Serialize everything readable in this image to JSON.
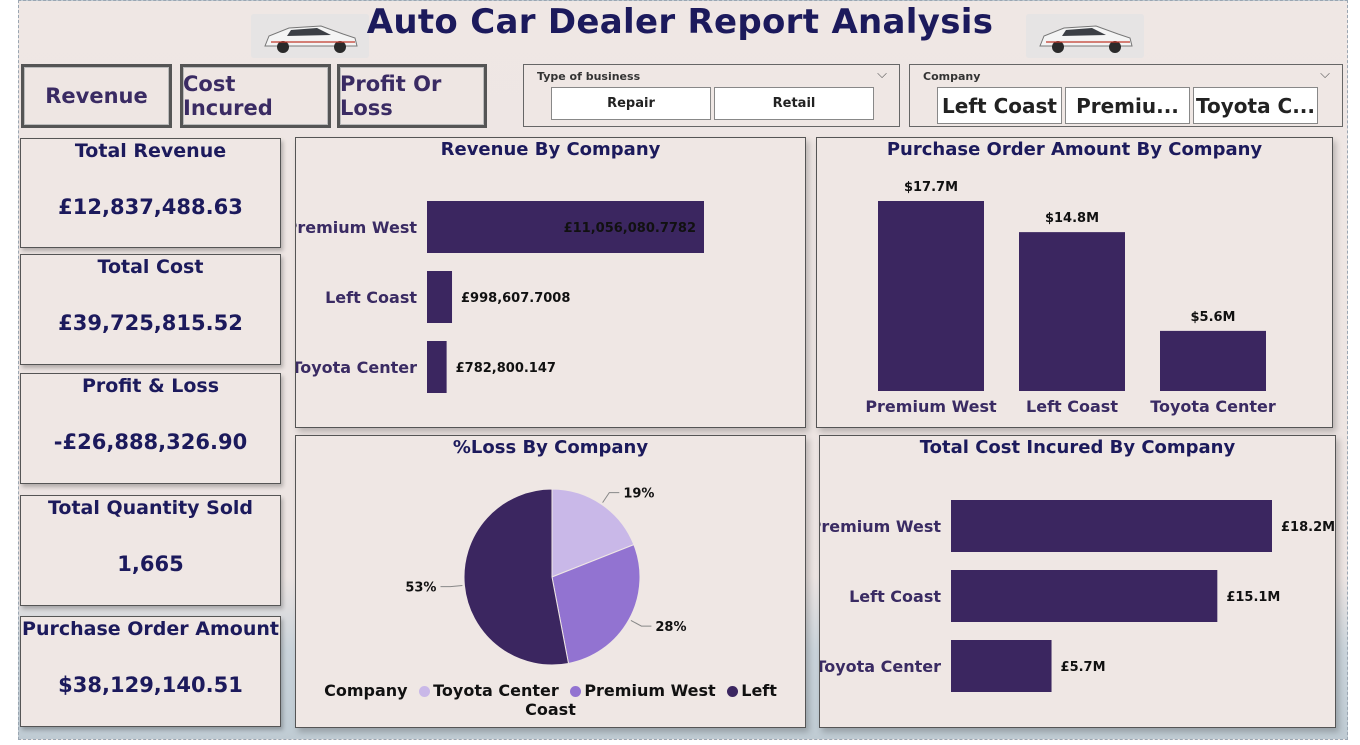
{
  "header": {
    "title": "Auto Car Dealer Report Analysis"
  },
  "nav": {
    "revenue": "Revenue",
    "cost": "Cost Incured",
    "profit": "Profit Or Loss"
  },
  "slicers": {
    "business": {
      "label": "Type of business",
      "options": [
        "Repair",
        "Retail"
      ]
    },
    "company": {
      "label": "Company",
      "options": [
        "Left Coast",
        "Premiu...",
        "Toyota C..."
      ]
    }
  },
  "kpis": [
    {
      "title": "Total Revenue",
      "value": "£12,837,488.63"
    },
    {
      "title": "Total Cost",
      "value": "£39,725,815.52"
    },
    {
      "title": "Profit & Loss",
      "value": "-£26,888,326.90"
    },
    {
      "title": "Total Quantity Sold",
      "value": "1,665"
    },
    {
      "title": "Purchase Order Amount",
      "value": "$38,129,140.51"
    }
  ],
  "colors": {
    "bar": "#3b2660",
    "pie": [
      "#c9b8e8",
      "#9273d1",
      "#3b2660"
    ],
    "title": "#1c1a5c"
  },
  "chart_data": [
    {
      "type": "bar",
      "orientation": "horizontal",
      "title": "Revenue By Company",
      "categories": [
        "Premium West",
        "Left Coast",
        "Toyota Center"
      ],
      "values": [
        11056080.7782,
        998607.7008,
        782800.147
      ],
      "labels": [
        "£11,056,080.7782",
        "£998,607.7008",
        "£782,800.147"
      ]
    },
    {
      "type": "bar",
      "orientation": "vertical",
      "title": "Purchase Order Amount By Company",
      "categories": [
        "Premium West",
        "Left Coast",
        "Toyota Center"
      ],
      "values": [
        17.7,
        14.8,
        5.6
      ],
      "labels": [
        "$17.7M",
        "$14.8M",
        "$5.6M"
      ]
    },
    {
      "type": "pie",
      "title": "%Loss By Company",
      "legend_title": "Company",
      "categories": [
        "Toyota Center",
        "Premium West",
        "Left Coast"
      ],
      "values": [
        19,
        28,
        53
      ],
      "labels": [
        "19%",
        "28%",
        "53%"
      ]
    },
    {
      "type": "bar",
      "orientation": "horizontal",
      "title": "Total Cost Incured By Company",
      "categories": [
        "Premium West",
        "Left Coast",
        "Toyota Center"
      ],
      "values": [
        18.2,
        15.1,
        5.7
      ],
      "labels": [
        "£18.2M",
        "£15.1M",
        "£5.7M"
      ]
    }
  ]
}
